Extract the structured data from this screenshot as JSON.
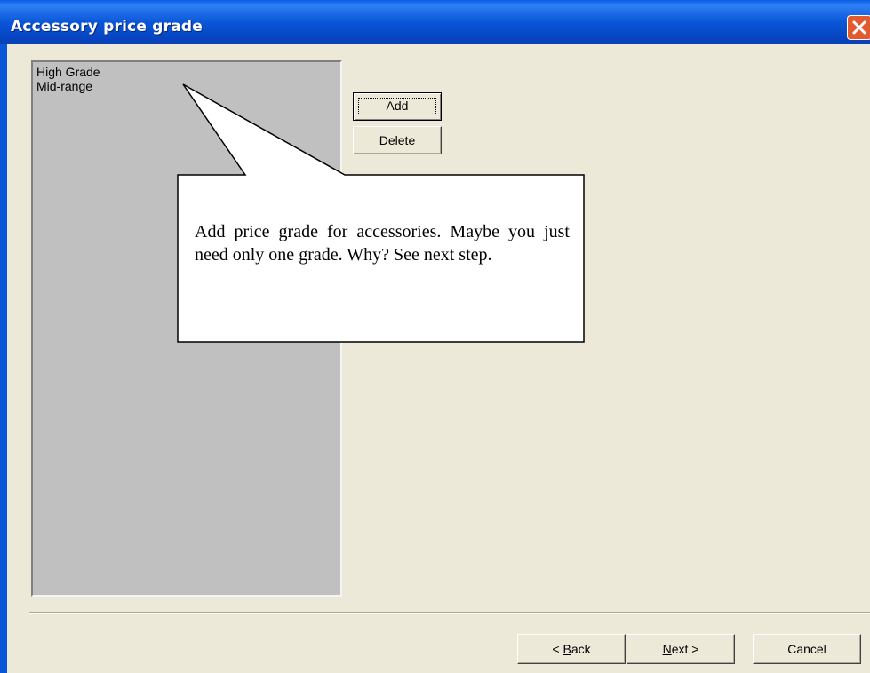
{
  "window": {
    "title": "Accessory price grade",
    "close_icon": "close-icon"
  },
  "grades_list": {
    "items": [
      "High Grade",
      "Mid-range"
    ]
  },
  "buttons": {
    "add_label": "Add",
    "delete_label": "Delete"
  },
  "callout": {
    "text": "Add price grade for accessories. Maybe you just need only one grade. Why? See next step."
  },
  "wizard_nav": {
    "back_prefix": "< ",
    "back_mnemonic": "B",
    "back_rest": "ack",
    "next_mnemonic": "N",
    "next_rest": "ext >",
    "cancel_label": "Cancel"
  },
  "colors": {
    "title_bar": "#0a56d8",
    "dialog_bg": "#ece9d8",
    "list_bg": "#c0c0c0",
    "close_button": "#e35a2e"
  }
}
